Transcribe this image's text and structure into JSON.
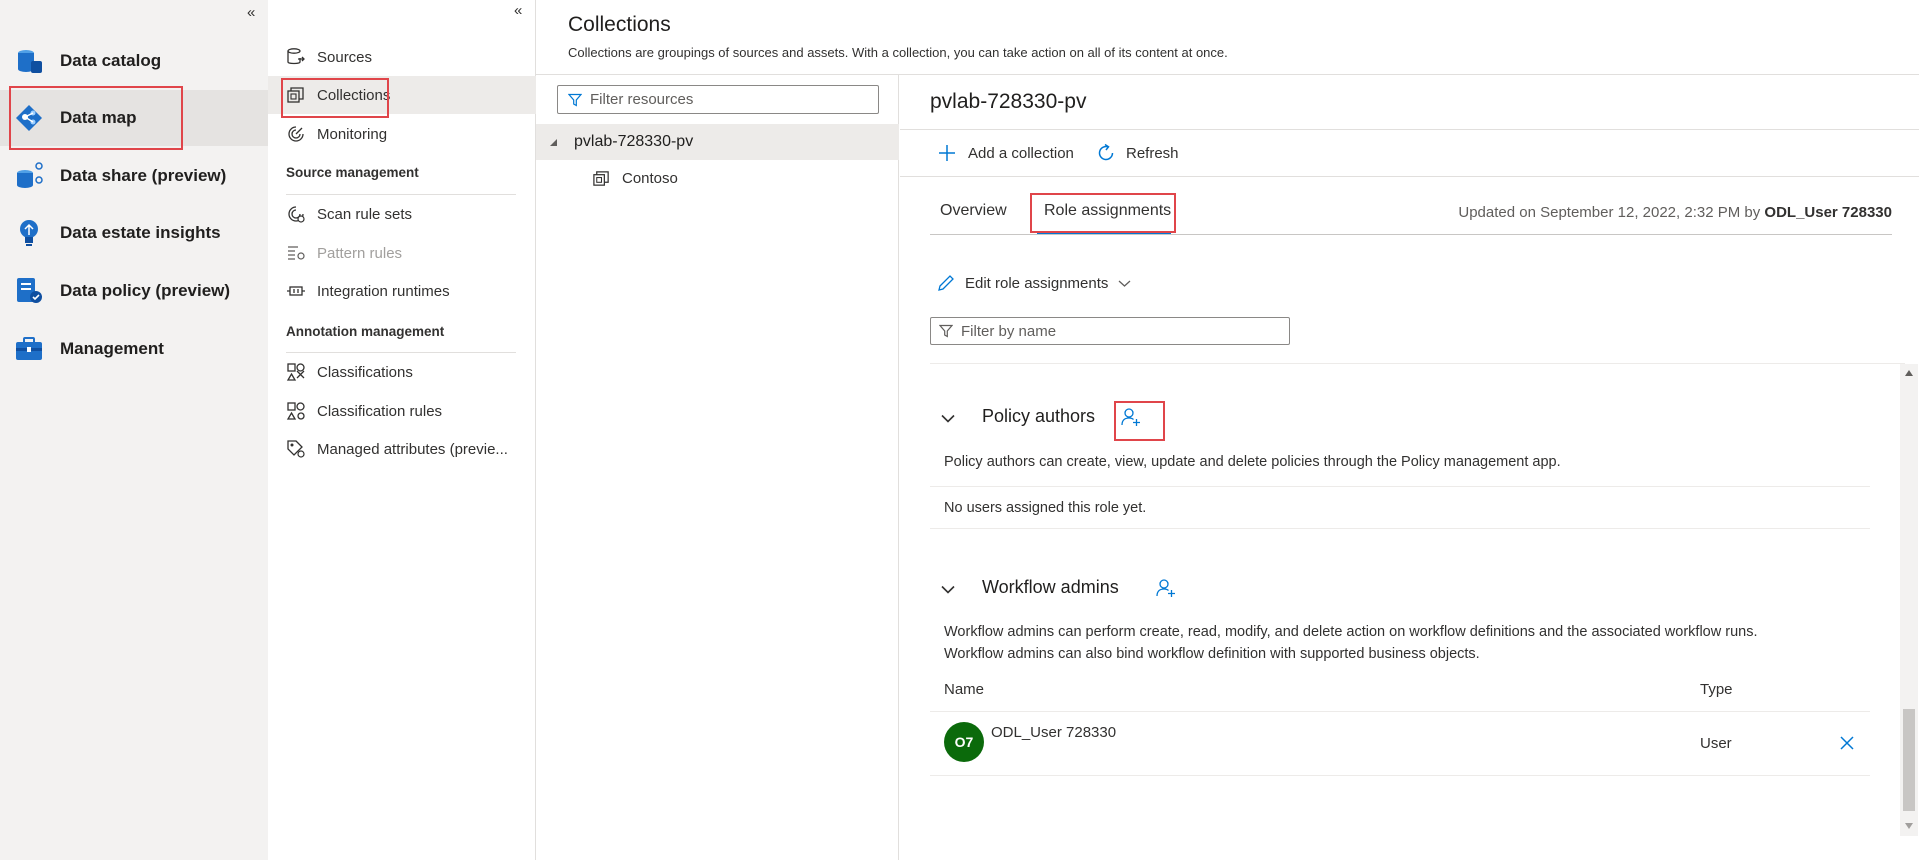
{
  "nav1": {
    "collapse_glyph": "«",
    "items": [
      {
        "label": "Data catalog",
        "icon": "data-catalog-icon"
      },
      {
        "label": "Data map",
        "icon": "data-map-icon"
      },
      {
        "label": "Data share (preview)",
        "icon": "data-share-icon"
      },
      {
        "label": "Data estate insights",
        "icon": "insights-icon"
      },
      {
        "label": "Data policy (preview)",
        "icon": "data-policy-icon"
      },
      {
        "label": "Management",
        "icon": "management-icon"
      }
    ],
    "active": "Data map"
  },
  "nav2": {
    "collapse_glyph": "«",
    "items": [
      {
        "label": "Sources",
        "icon": "sources-icon"
      },
      {
        "label": "Collections",
        "icon": "collections-icon"
      },
      {
        "label": "Monitoring",
        "icon": "monitoring-icon"
      }
    ],
    "source_management": {
      "heading": "Source management",
      "items": [
        {
          "label": "Scan rule sets",
          "icon": "scan-rule-sets-icon"
        },
        {
          "label": "Pattern rules",
          "icon": "pattern-rules-icon"
        },
        {
          "label": "Integration runtimes",
          "icon": "integration-runtimes-icon"
        }
      ]
    },
    "annotation_management": {
      "heading": "Annotation management",
      "items": [
        {
          "label": "Classifications",
          "icon": "classifications-icon"
        },
        {
          "label": "Classification rules",
          "icon": "classification-rules-icon"
        },
        {
          "label": "Managed attributes (previe...",
          "icon": "managed-attributes-icon"
        }
      ]
    }
  },
  "header": {
    "title": "Collections",
    "subtitle": "Collections are groupings of sources and assets. With a collection, you can take action on all of its content at once."
  },
  "tree": {
    "filter_placeholder": "Filter resources",
    "root": "pvlab-728330-pv",
    "child": "Contoso"
  },
  "detail": {
    "title": "pvlab-728330-pv",
    "commands": {
      "add": "Add a collection",
      "refresh": "Refresh"
    },
    "tabs": {
      "overview": "Overview",
      "role_assignments": "Role assignments"
    },
    "updated_prefix": "Updated on September 12, 2022, 2:32 PM by",
    "updated_by": "ODL_User 728330",
    "edit_label": "Edit role assignments",
    "filter_placeholder": "Filter by name",
    "policy_authors": {
      "title": "Policy authors",
      "description": "Policy authors can create, view, update and delete policies through the Policy management app.",
      "empty": "No users assigned this role yet."
    },
    "workflow_admins": {
      "title": "Workflow admins",
      "description1": "Workflow admins can perform create, read, modify, and delete action on workflow definitions and the associated workflow runs.",
      "description2": "Workflow admins can also bind workflow definition with supported business objects.",
      "col_name": "Name",
      "col_type": "Type",
      "user": {
        "initials": "O7",
        "name": "ODL_User 728330",
        "type": "User"
      }
    }
  },
  "colors": {
    "accent": "#0078d4",
    "highlight": "#e0454a",
    "avatar": "#0b6a0b"
  }
}
